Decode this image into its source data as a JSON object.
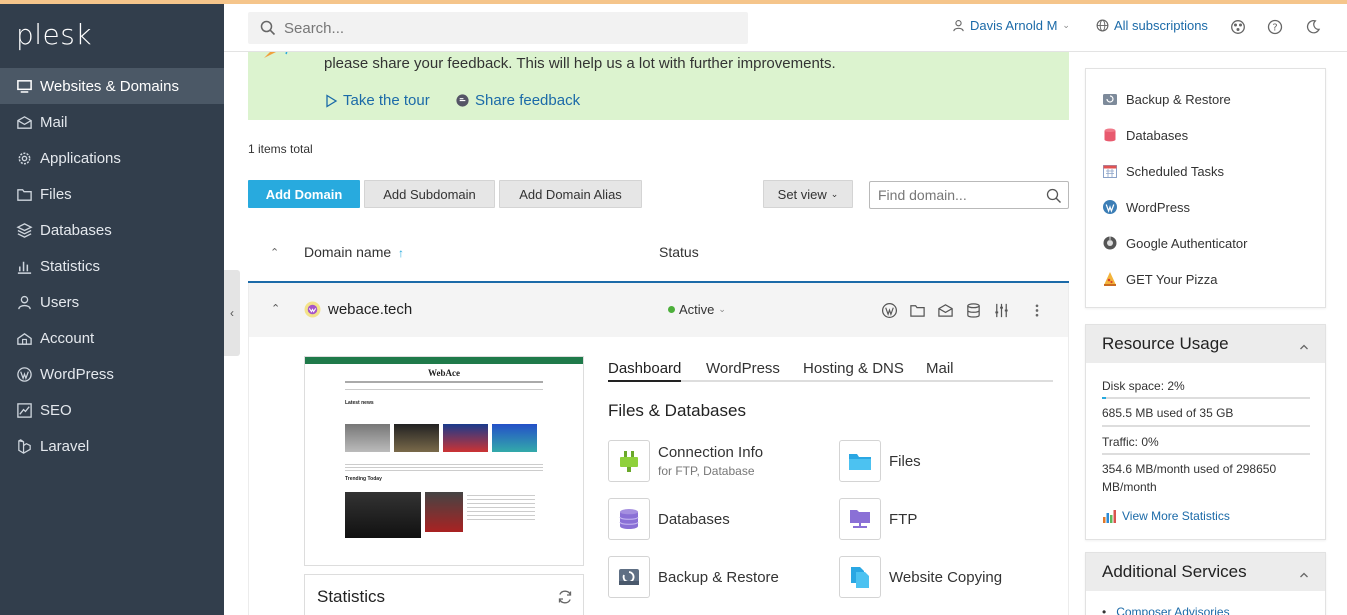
{
  "app": {
    "logo": "plesk"
  },
  "sidebar": {
    "items": [
      {
        "label": "Websites & Domains",
        "icon": "monitor-icon",
        "active": true
      },
      {
        "label": "Mail",
        "icon": "mail-icon"
      },
      {
        "label": "Applications",
        "icon": "gear-icon"
      },
      {
        "label": "Files",
        "icon": "folder-icon"
      },
      {
        "label": "Databases",
        "icon": "database-icon"
      },
      {
        "label": "Statistics",
        "icon": "bar-chart-icon"
      },
      {
        "label": "Users",
        "icon": "user-icon"
      },
      {
        "label": "Account",
        "icon": "account-icon"
      },
      {
        "label": "WordPress",
        "icon": "wordpress-icon"
      },
      {
        "label": "SEO",
        "icon": "seo-icon"
      },
      {
        "label": "Laravel",
        "icon": "laravel-icon"
      }
    ]
  },
  "topbar": {
    "search_placeholder": "Search...",
    "user": "Davis Arnold M",
    "subscriptions": "All subscriptions"
  },
  "banner": {
    "text": "please share your feedback. This will help us a lot with further improvements.",
    "tour": "Take the tour",
    "feedback": "Share feedback"
  },
  "list": {
    "total": "1 items total",
    "add_domain": "Add Domain",
    "add_subdomain": "Add Subdomain",
    "add_alias": "Add Domain Alias",
    "set_view": "Set view",
    "find_placeholder": "Find domain...",
    "col_domain": "Domain name",
    "col_status": "Status"
  },
  "domain": {
    "name": "webace.tech",
    "status": "Active",
    "status_color": "#4caf3a"
  },
  "preview": {
    "site_title": "WebAce",
    "section1": "Latest news",
    "section2": "Trending Today"
  },
  "stats_card": {
    "title": "Statistics"
  },
  "tabs": [
    "Dashboard",
    "WordPress",
    "Hosting & DNS",
    "Mail"
  ],
  "files_section": {
    "title": "Files & Databases",
    "tiles": [
      {
        "label": "Connection Info",
        "sub": "for FTP, Database",
        "icon": "plug-icon"
      },
      {
        "label": "Files",
        "icon": "folder-icon"
      },
      {
        "label": "Databases",
        "icon": "database-icon"
      },
      {
        "label": "FTP",
        "icon": "ftp-icon"
      },
      {
        "label": "Backup & Restore",
        "icon": "backup-icon"
      },
      {
        "label": "Website Copying",
        "icon": "copy-icon"
      }
    ]
  },
  "right_links": [
    {
      "label": "Backup & Restore",
      "icon": "backup-icon"
    },
    {
      "label": "Databases",
      "icon": "database-icon"
    },
    {
      "label": "Scheduled Tasks",
      "icon": "calendar-icon"
    },
    {
      "label": "WordPress",
      "icon": "wordpress-icon"
    },
    {
      "label": "Google Authenticator",
      "icon": "authenticator-icon"
    },
    {
      "label": "GET Your Pizza",
      "icon": "pizza-icon"
    }
  ],
  "resource_usage": {
    "title": "Resource Usage",
    "disk_label": "Disk space: 2%",
    "disk_pct": 2,
    "disk_detail": "685.5 MB used of 35 GB",
    "traffic_label": "Traffic: 0%",
    "traffic_pct": 0,
    "traffic_detail1": "354.6 MB/month used of 298650",
    "traffic_detail2": "MB/month",
    "more_stats": "View More Statistics"
  },
  "additional": {
    "title": "Additional Services",
    "first": "Composer Advisories"
  },
  "colors": {
    "sidebar": "#323e4c",
    "accent": "#28aade",
    "link": "#1b6aa8",
    "banner": "#dcf3cf"
  }
}
